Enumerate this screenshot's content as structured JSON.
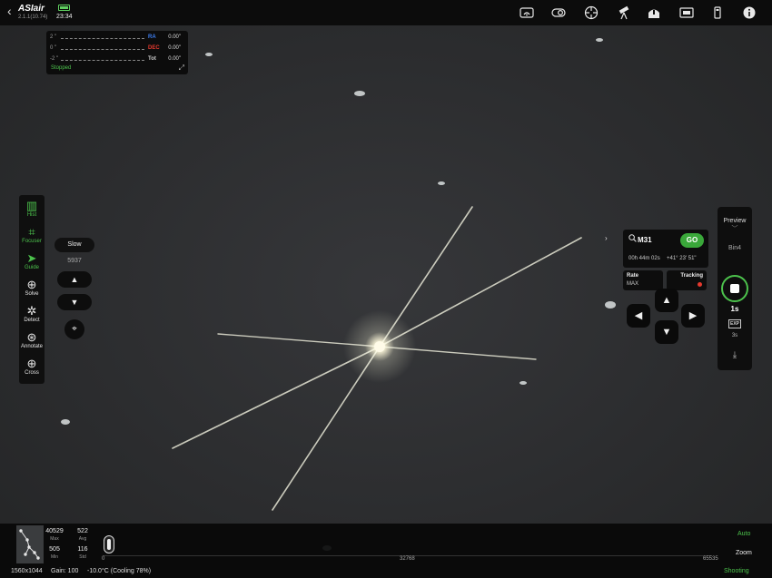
{
  "app": {
    "logo": "ASIair",
    "version": "2.1.1(10.74)",
    "back": "‹",
    "time": "23:34"
  },
  "topbar_icons": [
    "wifi-icon",
    "camera-link-icon",
    "guide-target-icon",
    "telescope-icon",
    "observatory-icon",
    "exposure-settings-icon",
    "usb-storage-icon",
    "info-icon"
  ],
  "guide_graph": {
    "ticks": [
      "2 \"",
      "0 \"",
      "-2 \""
    ],
    "rows": [
      {
        "label": "RA",
        "value": "0.00\"",
        "color": "#3d7ef0"
      },
      {
        "label": "DEC",
        "value": "0.00\"",
        "color": "#e5392e"
      },
      {
        "label": "Tot",
        "value": "0.00\"",
        "color": "#cccccc"
      }
    ],
    "status": "Stopped",
    "expand": "⤢"
  },
  "tools": [
    {
      "name": "hist",
      "label": "Hist",
      "icon": "▥",
      "active": true
    },
    {
      "name": "focuser",
      "label": "Focuser",
      "icon": "⌗",
      "active": true
    },
    {
      "name": "guide",
      "label": "Guide",
      "icon": "➤",
      "active": true
    },
    {
      "name": "solve",
      "label": "Solve",
      "icon": "⊕",
      "active": false
    },
    {
      "name": "detect",
      "label": "Detect",
      "icon": "✲",
      "active": false
    },
    {
      "name": "annotate",
      "label": "Annotate",
      "icon": "⊛",
      "active": false
    },
    {
      "name": "cross",
      "label": "Cross",
      "icon": "⊕",
      "active": false
    }
  ],
  "focuser": {
    "speed": "Slow",
    "position": "5937",
    "up": "▲",
    "down": "▼",
    "auto": "⌖"
  },
  "goto": {
    "collapse": "›",
    "target": "M31",
    "go": "GO",
    "ra": "00h 44m 02s",
    "dec": "+41° 23' 51\"",
    "rate_label": "Rate",
    "rate_value": "MAX",
    "tracking_label": "Tracking",
    "tracking_color": "#e5392e",
    "arrows": {
      "up": "▲",
      "down": "▼",
      "left": "◀",
      "right": "▶"
    }
  },
  "capture": {
    "mode": "Preview",
    "mode_chevron": "﹀",
    "bin": "Bin4",
    "exposure": "1s",
    "exp_icon": "EXP",
    "exp_sub": "3s",
    "download": "⤓"
  },
  "histogram": {
    "max": "40529",
    "max_label": "Max",
    "avg": "522",
    "avg_label": "Avg",
    "min": "505",
    "min_label": "Min",
    "std": "116",
    "std_label": "Std",
    "tick_min": "0",
    "tick_mid": "32768",
    "tick_max": "65535",
    "auto": "Auto",
    "zoom": "Zoom"
  },
  "status": {
    "resolution": "1560x1044",
    "gain": "Gain: 100",
    "temperature": "-10.0°C (Cooling 78%)",
    "state": "Shooting"
  },
  "colors": {
    "accent_green": "#4cc24c",
    "go_green": "#3aa83a",
    "panel": "#0c0c0c"
  }
}
